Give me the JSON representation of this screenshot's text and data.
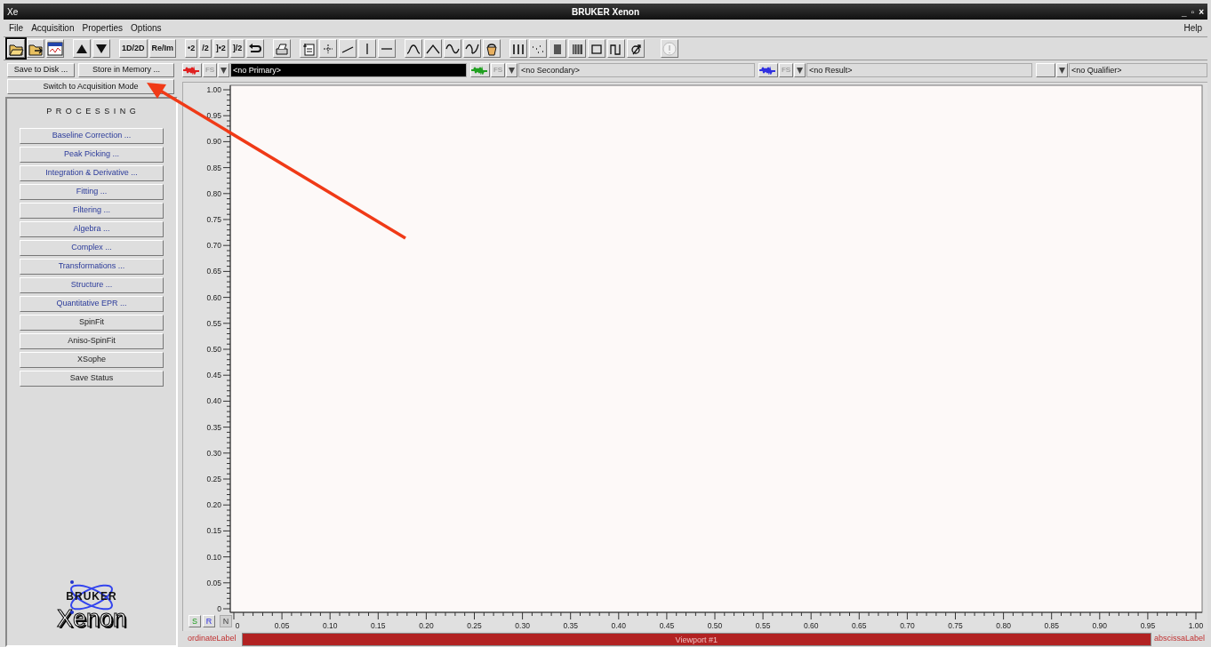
{
  "window": {
    "title": "BRUKER Xenon",
    "icon_text": "Xe",
    "controls": [
      "_",
      "▫",
      "×"
    ]
  },
  "menu": {
    "left": [
      "File",
      "Acquisition",
      "Properties",
      "Options"
    ],
    "right": [
      "Help"
    ]
  },
  "toolbar_texts": [
    "1D/2D",
    "Re/Im",
    "•2",
    "/2",
    "]•2",
    "]/2"
  ],
  "actions": [
    "Save to Disk ...",
    "Store in Memory ..."
  ],
  "mode_button": "Switch to Acquisition Mode",
  "datasets": [
    {
      "color": "#e02020",
      "fs": "FS",
      "value": "<no Primary>",
      "highlighted": true
    },
    {
      "color": "#20a020",
      "fs": "FS",
      "value": "<no Secondary>",
      "highlighted": false
    },
    {
      "color": "#3030e0",
      "fs": "FS",
      "value": "<no Result>",
      "highlighted": false
    },
    {
      "value": "<no Qualifier>",
      "highlighted": false
    }
  ],
  "processing": {
    "title": "P R O C E S S I N G",
    "buttons": [
      {
        "label": "Baseline Correction ...",
        "dialog": true
      },
      {
        "label": "Peak Picking ...",
        "dialog": true
      },
      {
        "label": "Integration & Derivative ...",
        "dialog": true
      },
      {
        "label": "Fitting ...",
        "dialog": true
      },
      {
        "label": "Filtering ...",
        "dialog": true
      },
      {
        "label": "Algebra ...",
        "dialog": true
      },
      {
        "label": "Complex ...",
        "dialog": true
      },
      {
        "label": "Transformations ...",
        "dialog": true
      },
      {
        "label": "Structure ...",
        "dialog": true
      },
      {
        "label": "Quantitative EPR ...",
        "dialog": true
      },
      {
        "label": "SpinFit",
        "dialog": false
      },
      {
        "label": "Aniso-SpinFit",
        "dialog": false
      },
      {
        "label": "XSophe",
        "dialog": false
      },
      {
        "label": "Save Status",
        "dialog": false
      }
    ]
  },
  "logo": {
    "brand": "BRUKER",
    "product": "Xenon"
  },
  "plot": {
    "y_ticks": [
      "1.00",
      "0.95",
      "0.90",
      "0.85",
      "0.80",
      "0.75",
      "0.70",
      "0.65",
      "0.60",
      "0.55",
      "0.50",
      "0.45",
      "0.40",
      "0.35",
      "0.30",
      "0.25",
      "0.20",
      "0.15",
      "0.10",
      "0.05",
      "0"
    ],
    "x_ticks": [
      "0",
      "0.05",
      "0.10",
      "0.15",
      "0.20",
      "0.25",
      "0.30",
      "0.35",
      "0.40",
      "0.45",
      "0.50",
      "0.55",
      "0.60",
      "0.65",
      "0.70",
      "0.75",
      "0.80",
      "0.85",
      "0.90",
      "0.95",
      "1.00"
    ],
    "view_buttons": [
      {
        "label": "S",
        "kind": "secondary",
        "enabled": true
      },
      {
        "label": "R",
        "kind": "result",
        "enabled": true
      },
      {
        "label": "N",
        "kind": "plain",
        "enabled": false
      }
    ],
    "ordinate_label": "ordinateLabel",
    "viewport": "Viewport #1",
    "abscissa_label": "abscissaLabel"
  },
  "annotation": {
    "kind": "arrow"
  }
}
